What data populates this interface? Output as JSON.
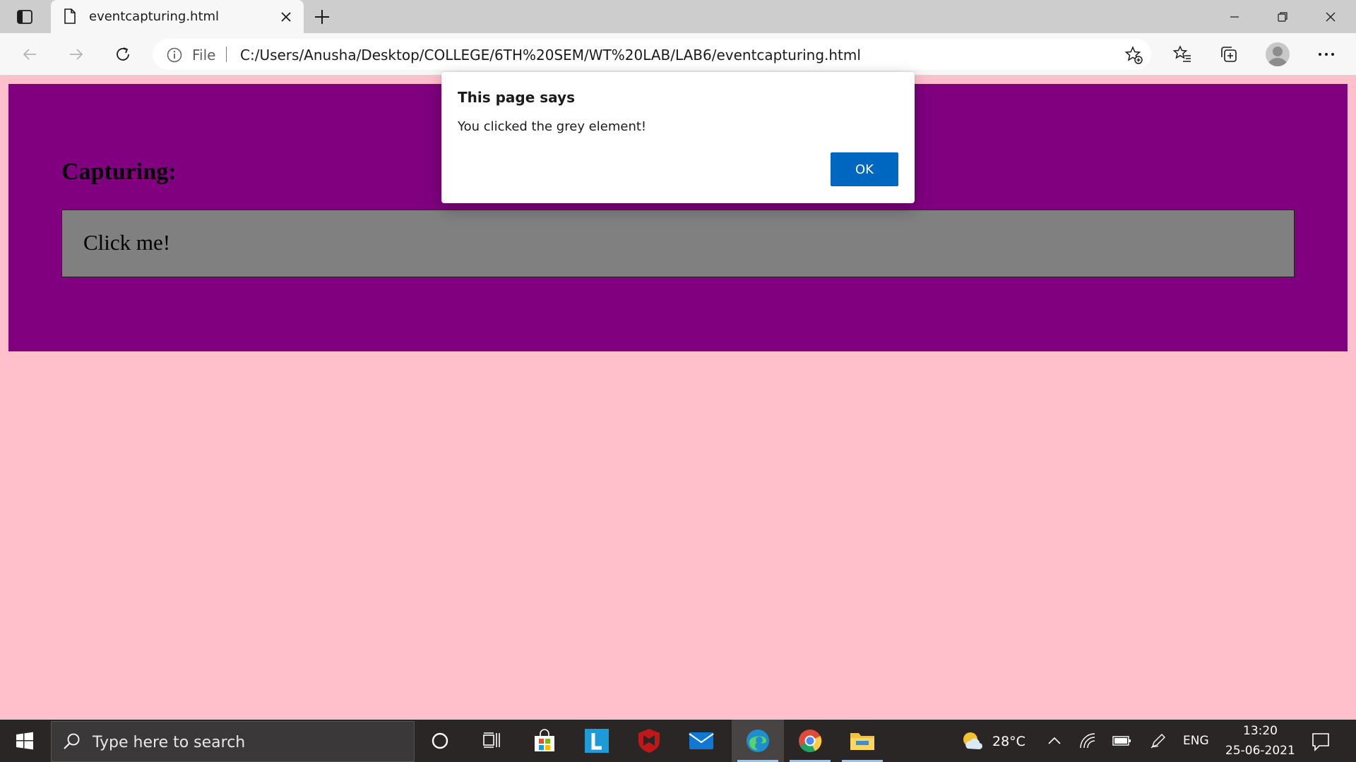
{
  "browser": {
    "tab": {
      "title": "eventcapturing.html"
    },
    "address": {
      "scheme_label": "File",
      "url": "C:/Users/Anusha/Desktop/COLLEGE/6TH%20SEM/WT%20LAB/LAB6/eventcapturing.html"
    }
  },
  "page": {
    "heading": "Capturing:",
    "grey_box_text": "Click me!",
    "colors": {
      "background": "#ffc0cb",
      "outer": "#800080",
      "inner": "#808080"
    }
  },
  "dialog": {
    "title": "This page says",
    "message": "You clicked the grey element!",
    "ok_label": "OK"
  },
  "taskbar": {
    "search_placeholder": "Type here to search",
    "weather": "28°C",
    "language": "ENG",
    "time": "13:20",
    "date": "25-06-2021"
  }
}
